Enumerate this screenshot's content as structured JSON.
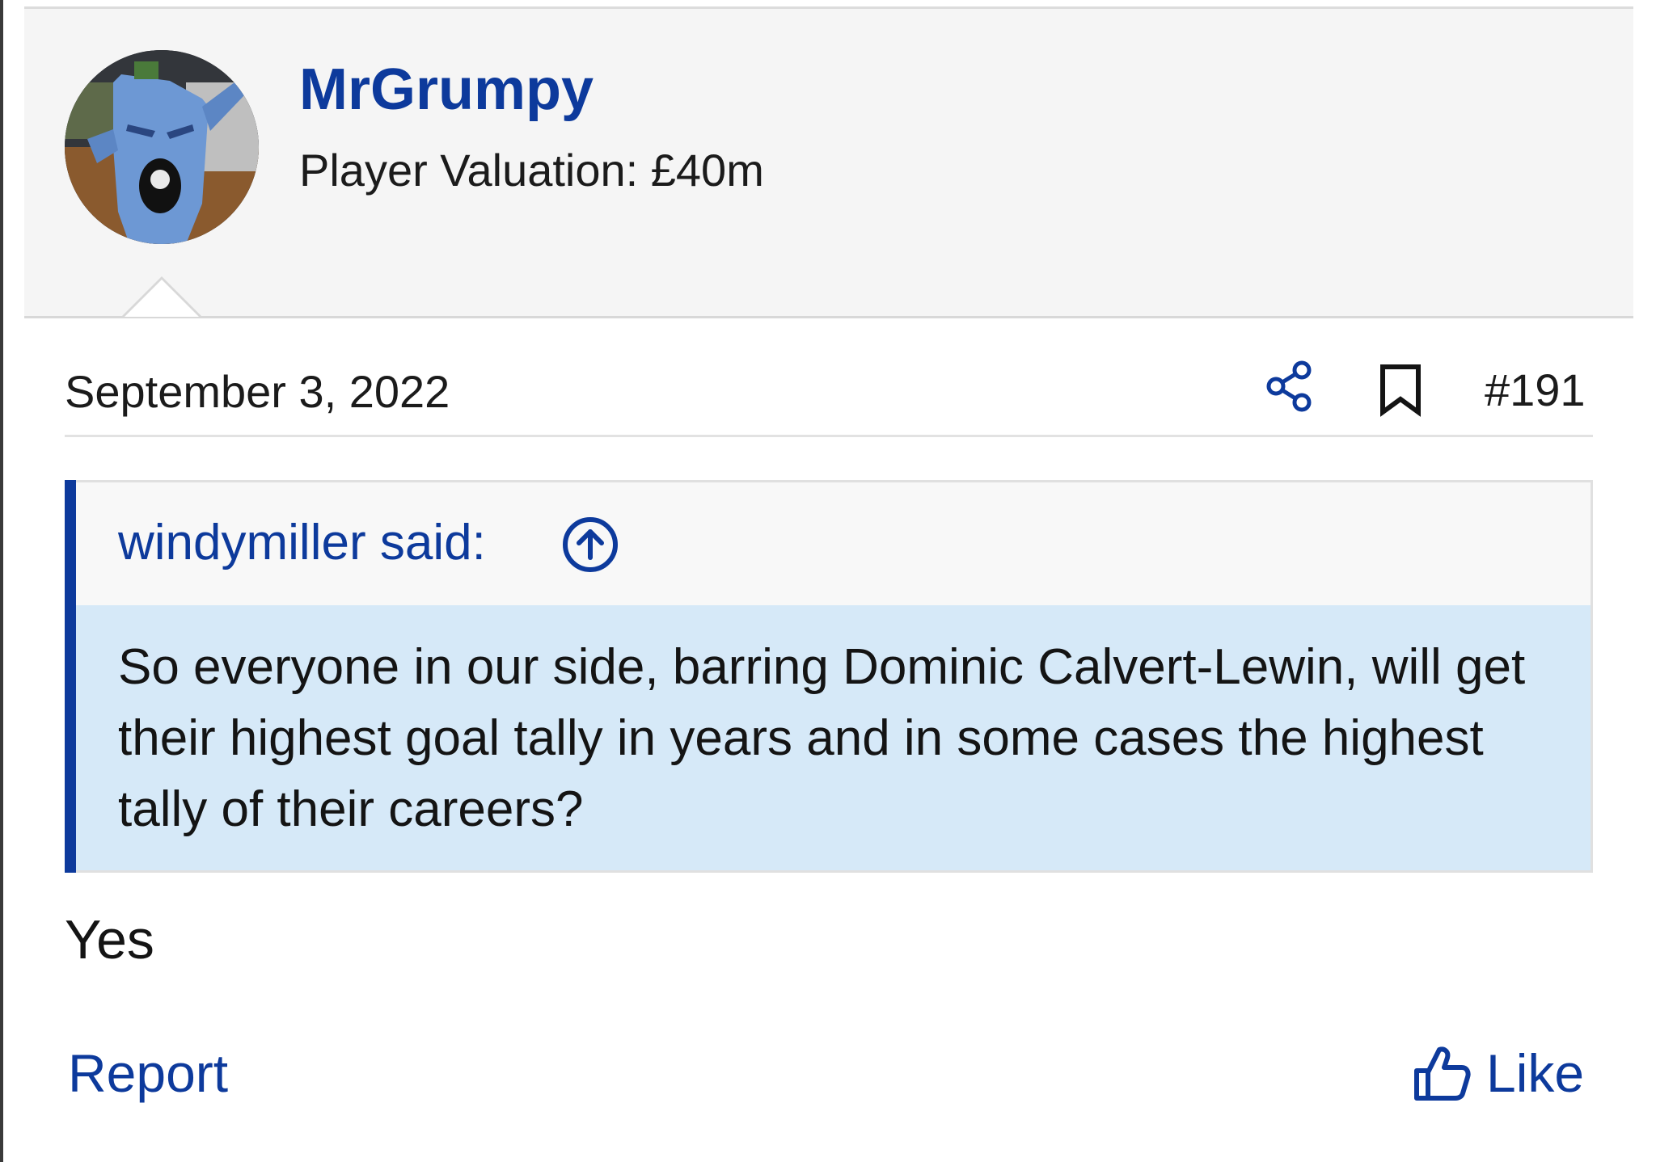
{
  "post": {
    "author": {
      "username": "MrGrumpy",
      "valuation": "Player Valuation: £40m",
      "avatar_icon": "avatar-image"
    },
    "date": "September 3, 2022",
    "post_number": "#191",
    "quote": {
      "attribution": "windymiller said:",
      "text": "So everyone in our side, barring Dominic Calvert-Lewin, will get their highest goal tally in years and in some cases the highest tally of their careers?"
    },
    "body": "Yes",
    "actions": {
      "report_label": "Report",
      "like_label": "Like"
    }
  },
  "colors": {
    "accent": "#0d3a9c",
    "quote_background": "#d6e9f8",
    "header_background": "#f5f5f5"
  }
}
